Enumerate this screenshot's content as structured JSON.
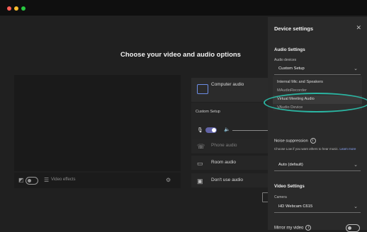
{
  "window": {
    "traffic_lights": [
      "close",
      "minimize",
      "zoom"
    ]
  },
  "page_title": "Choose your video and audio options",
  "video_controls": {
    "video_effects_label": "Video effects"
  },
  "audio_options": {
    "computer_audio": "Computer audio",
    "custom_setup": "Custom Setup",
    "phone_audio": "Phone audio",
    "room_audio": "Room audio",
    "dont_use_audio": "Don't use audio"
  },
  "device_settings": {
    "title": "Device settings",
    "audio_settings": "Audio Settings",
    "audio_devices_label": "Audio devices",
    "audio_devices_value": "Custom Setup",
    "audio_devices_options": [
      "Internal Mic and Speakers",
      "MAudioRecorder",
      "Virtual Meeting Audio",
      "VAudio Device"
    ],
    "noise_suppression": "Noise suppression",
    "noise_desc": "Choose Low if you want others to hear music.",
    "learn_more": "Learn more",
    "noise_value": "Auto (default)",
    "video_settings": "Video Settings",
    "camera_label": "Camera",
    "camera_value": "HD Webcam C615",
    "mirror_label": "Mirror my video"
  },
  "colors": {
    "accent": "#6264a7",
    "highlight": "#2bb5a2"
  }
}
